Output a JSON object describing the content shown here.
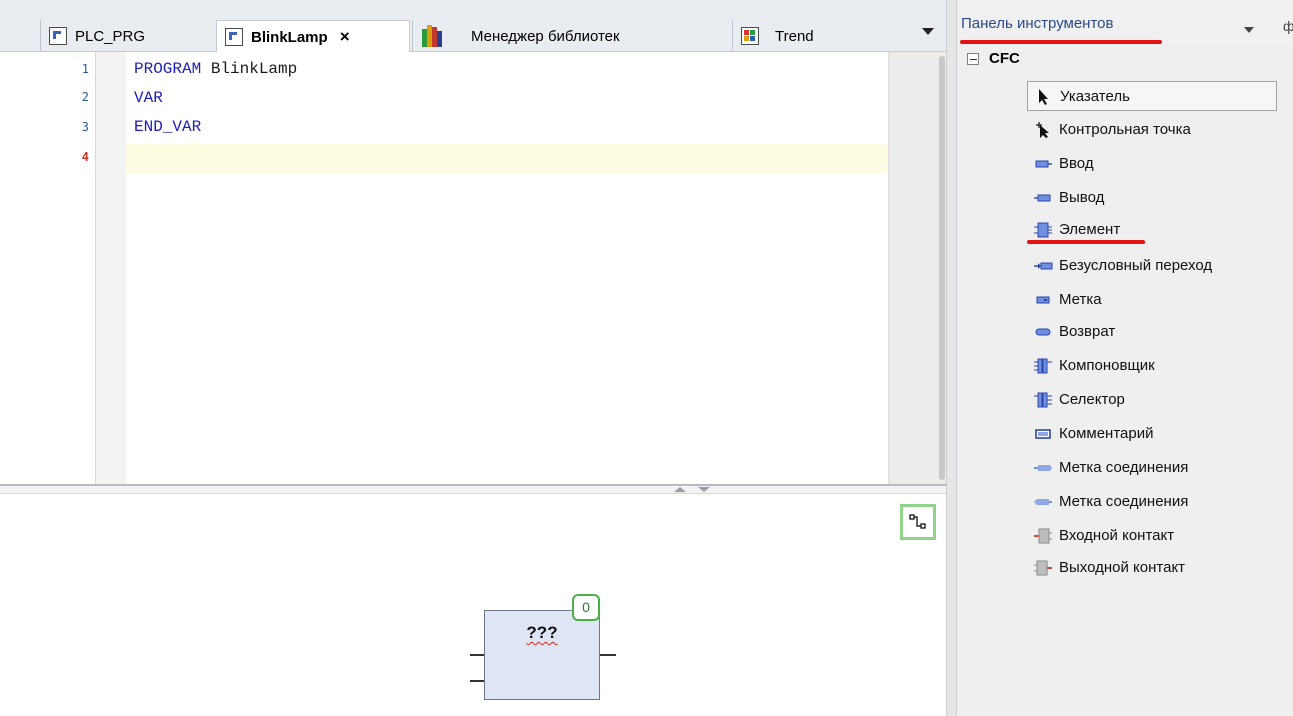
{
  "tabs": [
    {
      "label": "PLC_PRG",
      "icon": "program-icon",
      "active": false
    },
    {
      "label": "BlinkLamp",
      "icon": "program-icon",
      "active": true,
      "close": "×"
    },
    {
      "label": "Менеджер библиотек",
      "icon": "library-manager-icon",
      "active": false
    },
    {
      "label": "Trend",
      "icon": "trend-icon",
      "active": false
    }
  ],
  "editor": {
    "line_numbers": [
      "1",
      "2",
      "3",
      "4"
    ],
    "lines": [
      {
        "kw": "PROGRAM",
        "rest": " BlinkLamp"
      },
      {
        "kw": "VAR",
        "rest": ""
      },
      {
        "kw": "END_VAR",
        "rest": ""
      },
      {
        "kw": "",
        "rest": ""
      }
    ]
  },
  "cfc": {
    "block_name": "???",
    "execution_order": "0"
  },
  "toolbox": {
    "title": "Панель инструментов",
    "pin_glyph": "ф",
    "category": "CFC",
    "items": [
      {
        "label": "Указатель",
        "icon": "pointer-icon"
      },
      {
        "label": "Контрольная точка",
        "icon": "breakpoint-icon"
      },
      {
        "label": "Ввод",
        "icon": "input-icon"
      },
      {
        "label": "Вывод",
        "icon": "output-icon"
      },
      {
        "label": "Элемент",
        "icon": "box-icon"
      },
      {
        "label": "Безусловный переход",
        "icon": "jump-icon"
      },
      {
        "label": "Метка",
        "icon": "label-icon"
      },
      {
        "label": "Возврат",
        "icon": "return-icon"
      },
      {
        "label": "Компоновщик",
        "icon": "composer-icon"
      },
      {
        "label": "Селектор",
        "icon": "selector-icon"
      },
      {
        "label": "Комментарий",
        "icon": "comment-icon"
      },
      {
        "label": "Метка соединения",
        "icon": "connection-mark-source-icon"
      },
      {
        "label": "Метка соединения",
        "icon": "connection-mark-sink-icon"
      },
      {
        "label": "Входной контакт",
        "icon": "input-pin-icon"
      },
      {
        "label": "Выходной контакт",
        "icon": "output-pin-icon"
      }
    ]
  },
  "colors": {
    "keyword": "#1d1db8",
    "highlight_marker": "#e31414",
    "current_line": "#fdfbe2",
    "block_fill": "#dfe6f3",
    "exec_order_border": "#49b04a"
  }
}
